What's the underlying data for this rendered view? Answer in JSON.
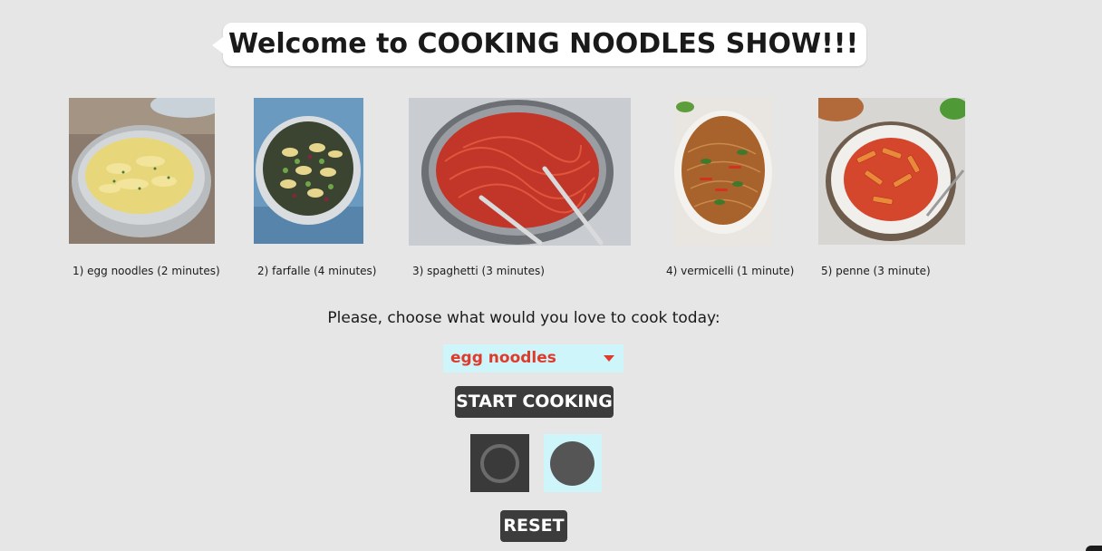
{
  "header": {
    "title": "Welcome to COOKING NOODLES SHOW!!!"
  },
  "noodles": [
    {
      "caption": "1) egg noodles (2 minutes)",
      "icon": "egg-noodles-photo"
    },
    {
      "caption": "2) farfalle (4 minutes)",
      "icon": "farfalle-photo"
    },
    {
      "caption": "3) spaghetti (3 minutes)",
      "icon": "spaghetti-photo"
    },
    {
      "caption": "4) vermicelli (1 minute)",
      "icon": "vermicelli-photo"
    },
    {
      "caption": "5) penne (3 minute)",
      "icon": "penne-photo"
    }
  ],
  "prompt": "Please, choose what would you love to cook today:",
  "select": {
    "value": "egg noodles"
  },
  "buttons": {
    "start": "START COOKING",
    "reset": "RESET"
  },
  "icons": {
    "ring": "ring-icon",
    "dot": "dot-icon",
    "caret": "caret-down-icon"
  },
  "colors": {
    "background": "#e6e6e6",
    "select_bg": "#cdf5fa",
    "select_text": "#e03a2a",
    "button_bg": "#3c3c3c",
    "button_text": "#ffffff"
  }
}
